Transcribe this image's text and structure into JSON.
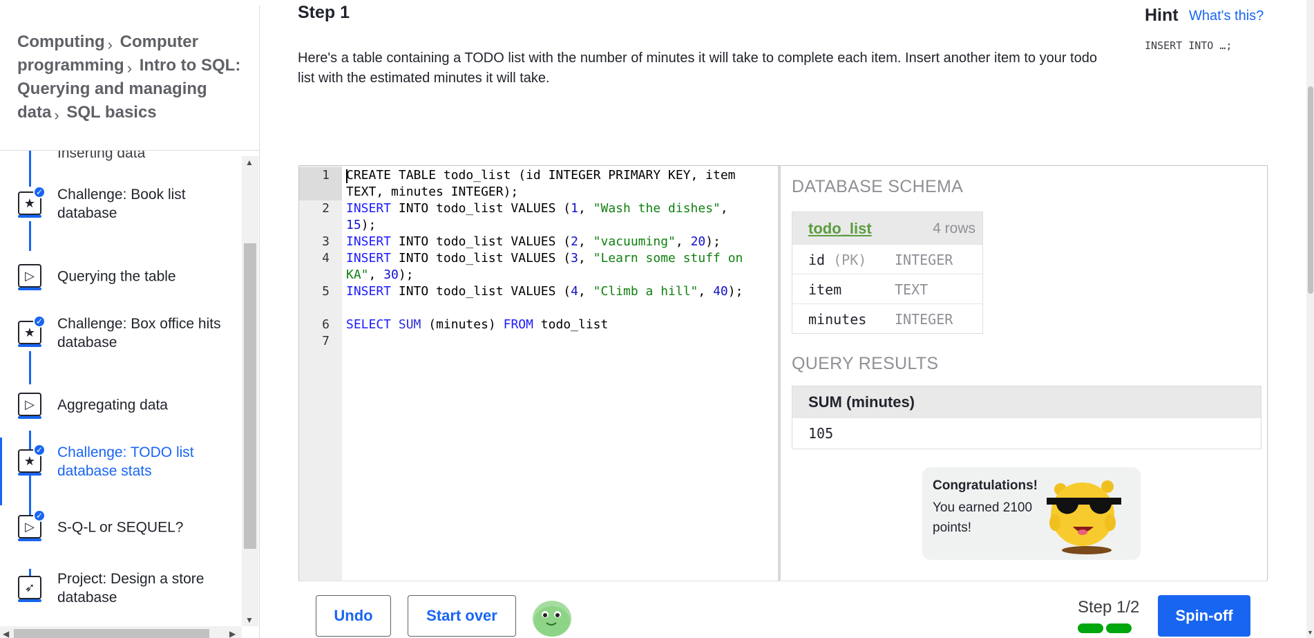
{
  "breadcrumb": {
    "items": [
      "Computing",
      "Computer programming",
      "Intro to SQL: Querying and managing data",
      "SQL basics"
    ],
    "separator": "›"
  },
  "sidebar": {
    "cut_item": "Inserting data",
    "items": [
      {
        "label": "Challenge: Book list database",
        "icon": "star-icon",
        "done": true,
        "active": false
      },
      {
        "label": "Querying the table",
        "icon": "play-icon",
        "done": false,
        "active": false
      },
      {
        "label": "Challenge: Box office hits database",
        "icon": "star-icon",
        "done": true,
        "active": false
      },
      {
        "label": "Aggregating data",
        "icon": "play-icon",
        "done": false,
        "active": false
      },
      {
        "label": "Challenge: TODO list database stats",
        "icon": "star-icon",
        "done": true,
        "active": true
      },
      {
        "label": "S-Q-L or SEQUEL?",
        "icon": "play-icon",
        "done": true,
        "active": false
      },
      {
        "label": "Project: Design a store database",
        "icon": "rocket-icon",
        "done": false,
        "active": false
      }
    ]
  },
  "step": {
    "title": "Step 1",
    "instructions": "Here's a table containing a TODO list with the number of minutes it will take to complete each item. Insert another item to your todo list with the estimated minutes it will take."
  },
  "hint": {
    "title": "Hint",
    "link": "What's this?",
    "code": "INSERT INTO …;"
  },
  "editor": {
    "line_numbers": [
      "1",
      "2",
      "3",
      "4",
      "5",
      "6",
      "7"
    ]
  },
  "schema": {
    "section_title": "DATABASE SCHEMA",
    "table_name": "todo_list",
    "row_count": "4 rows",
    "columns": [
      {
        "name": "id",
        "pk": "(PK)",
        "type": "INTEGER"
      },
      {
        "name": "item",
        "pk": "",
        "type": "TEXT"
      },
      {
        "name": "minutes",
        "pk": "",
        "type": "INTEGER"
      }
    ]
  },
  "results": {
    "section_title": "QUERY RESULTS",
    "header": "SUM (minutes)",
    "value": "105"
  },
  "congrats": {
    "title": "Congratulations!",
    "message": "You earned 2100 points!"
  },
  "toolbar": {
    "undo_label": "Undo",
    "start_over_label": "Start over",
    "step_count": "Step 1/2",
    "spin_off_label": "Spin-off",
    "progress_steps_done": 2,
    "progress_steps_total": 2
  },
  "colors": {
    "accent": "#1865f2",
    "progress": "#00a60e",
    "table_link": "#5b9d3d"
  }
}
